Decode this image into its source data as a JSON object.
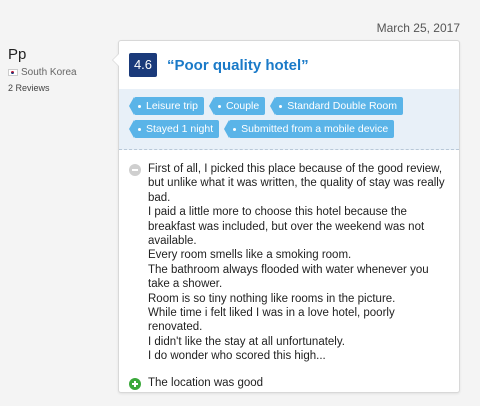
{
  "review_date": "March 25, 2017",
  "reviewer": {
    "name": "Pp",
    "country": "South Korea",
    "reviews_count": "2 Reviews"
  },
  "review": {
    "score": "4.6",
    "title": "“Poor quality hotel”",
    "tags_row1": [
      "Leisure trip",
      "Couple",
      "Standard Double Room"
    ],
    "tags_row2": [
      "Stayed 1 night",
      "Submitted from a mobile device"
    ],
    "negative_lines": [
      "First of all, I picked this place because of the good review, but unlike what it was written, the quality of stay was really bad.",
      "I paid a little more to choose this hotel because the breakfast was included, but over the weekend was not available.",
      "Every room smells like a smoking room.",
      "The bathroom always flooded with water whenever you take a shower.",
      "Room is so tiny nothing like rooms in the picture.",
      "While time i felt liked I was in a love hotel, poorly renovated.",
      "I didn't like the stay at all unfortunately.",
      "I do wonder who scored this high..."
    ],
    "positive": "The location was good"
  },
  "colors": {
    "score_badge": "#1a3a7a",
    "title": "#1a7ac8",
    "tag": "#5ab4e8",
    "tags_bg": "#e8f0f8",
    "positive_icon": "#3aa83a",
    "negative_icon": "#cfcfcf"
  },
  "icons": {
    "flag": "south-korea-flag-icon",
    "negative": "minus-circle-icon",
    "positive": "plus-circle-icon"
  }
}
